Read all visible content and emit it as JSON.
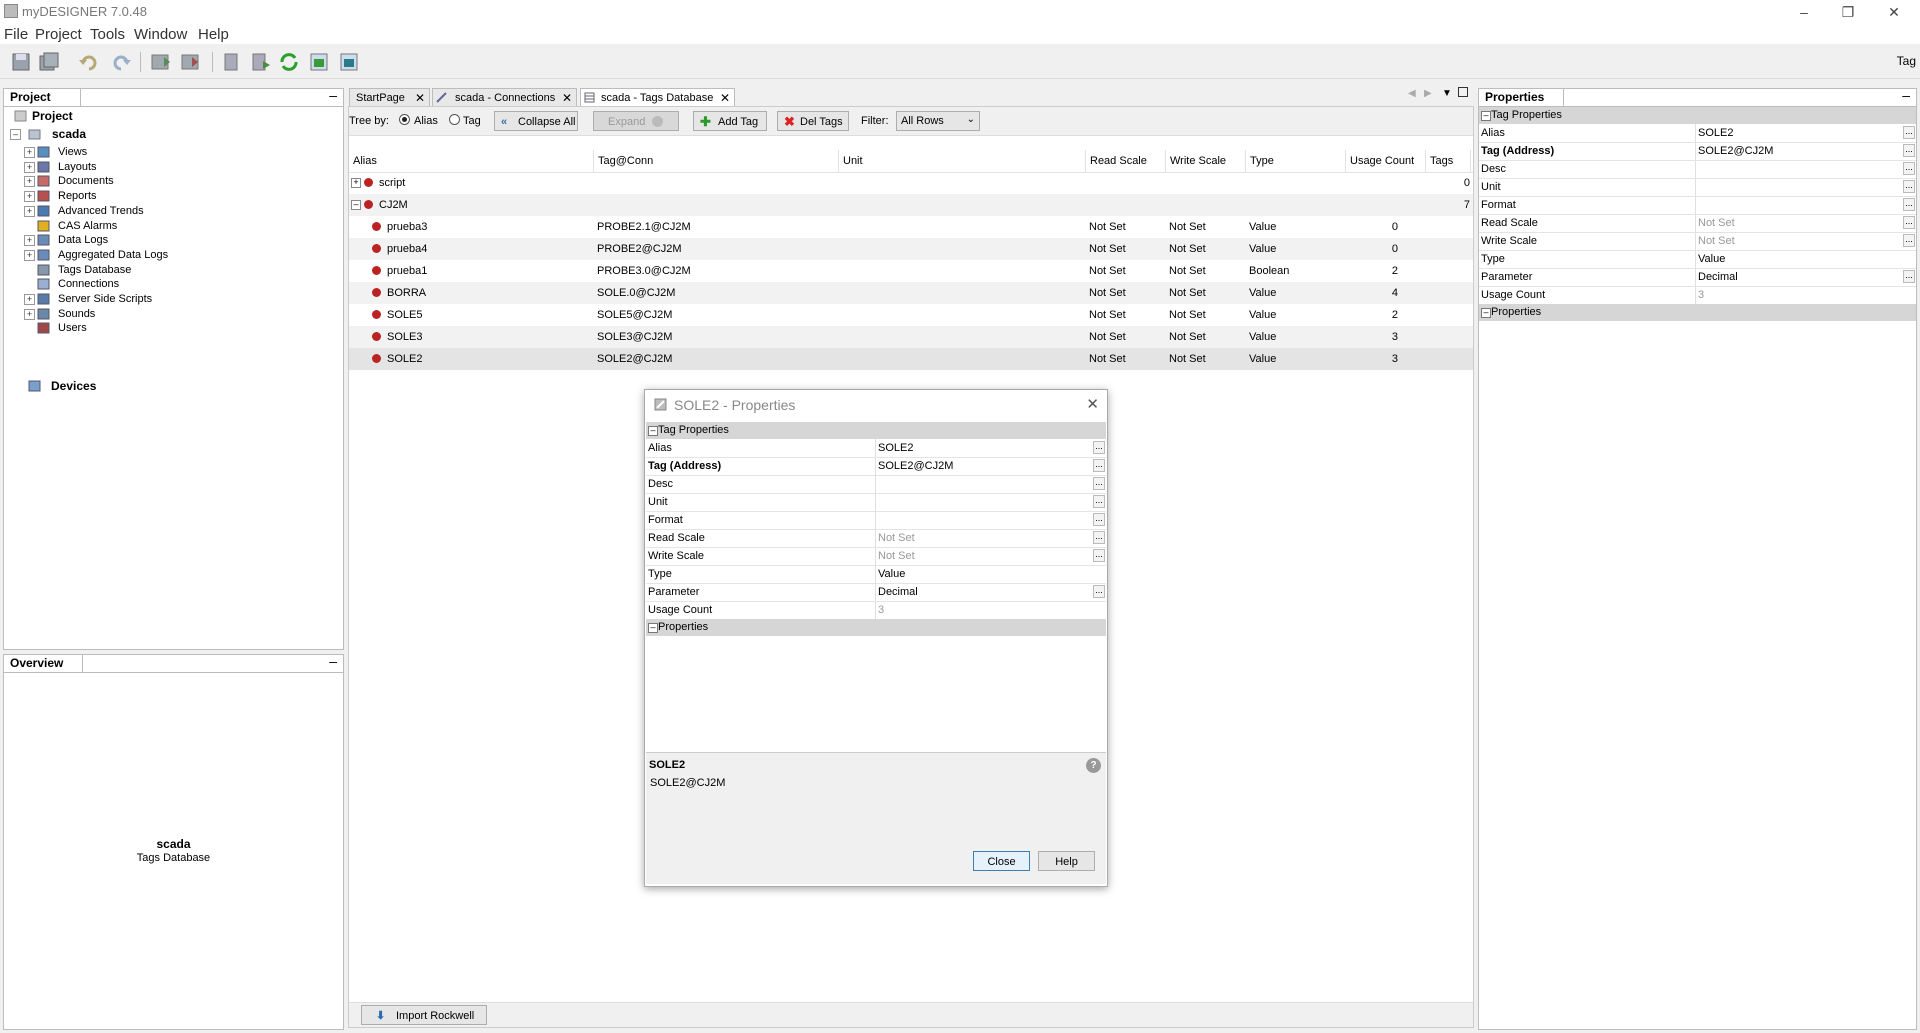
{
  "window": {
    "title": "myDESIGNER 7.0.48",
    "controls": [
      "–",
      "❐",
      "✕"
    ]
  },
  "menu": [
    "File",
    "Project",
    "Tools",
    "Window",
    "Help"
  ],
  "toolbar_right_label": "Tag",
  "project_panel": {
    "title": "Project",
    "root": "Project",
    "project": "scada",
    "items": [
      "Views",
      "Layouts",
      "Documents",
      "Reports",
      "Advanced Trends",
      "CAS Alarms",
      "Data Logs",
      "Aggregated Data Logs",
      "Tags Database",
      "Connections",
      "Server Side Scripts",
      "Sounds",
      "Users"
    ],
    "devices": "Devices"
  },
  "overview_panel": {
    "title": "Overview",
    "line1": "scada",
    "line2": "Tags Database"
  },
  "tabs": [
    "StartPage",
    "scada - Connections",
    "scada - Tags Database"
  ],
  "tags_toolbar": {
    "tree_by": "Tree by:",
    "opt_alias": "Alias",
    "opt_tag": "Tag",
    "collapse_all": "Collapse All",
    "expand": "Expand",
    "add_tag": "Add Tag",
    "del_tags": "Del Tags",
    "filter_label": "Filter:",
    "filter_value": "All Rows"
  },
  "grid": {
    "headers": [
      "Alias",
      "Tag@Conn",
      "Unit",
      "Read Scale",
      "Write Scale",
      "Type",
      "Usage Count",
      "Tags"
    ],
    "groups": [
      {
        "name": "script",
        "tags": "0"
      },
      {
        "name": "CJ2M",
        "tags": "7"
      }
    ],
    "rows": [
      {
        "alias": "prueba3",
        "conn": "PROBE2.1@CJ2M",
        "unit": "",
        "read": "Not Set",
        "write": "Not Set",
        "type": "Value",
        "usage": "0"
      },
      {
        "alias": "prueba4",
        "conn": "PROBE2@CJ2M",
        "unit": "",
        "read": "Not Set",
        "write": "Not Set",
        "type": "Value",
        "usage": "0"
      },
      {
        "alias": "prueba1",
        "conn": "PROBE3.0@CJ2M",
        "unit": "",
        "read": "Not Set",
        "write": "Not Set",
        "type": "Boolean",
        "usage": "2"
      },
      {
        "alias": "BORRA",
        "conn": "SOLE.0@CJ2M",
        "unit": "",
        "read": "Not Set",
        "write": "Not Set",
        "type": "Value",
        "usage": "4"
      },
      {
        "alias": "SOLE5",
        "conn": "SOLE5@CJ2M",
        "unit": "",
        "read": "Not Set",
        "write": "Not Set",
        "type": "Value",
        "usage": "2"
      },
      {
        "alias": "SOLE3",
        "conn": "SOLE3@CJ2M",
        "unit": "",
        "read": "Not Set",
        "write": "Not Set",
        "type": "Value",
        "usage": "3"
      },
      {
        "alias": "SOLE2",
        "conn": "SOLE2@CJ2M",
        "unit": "",
        "read": "Not Set",
        "write": "Not Set",
        "type": "Value",
        "usage": "3"
      }
    ]
  },
  "import_button": "Import Rockwell",
  "properties_panel": {
    "title": "Properties",
    "category1": "Tag Properties",
    "category2": "Properties",
    "props": [
      {
        "name": "Alias",
        "value": "SOLE2",
        "bold": false,
        "dots": true,
        "grey": false
      },
      {
        "name": "Tag (Address)",
        "value": "SOLE2@CJ2M",
        "bold": true,
        "dots": true,
        "grey": false
      },
      {
        "name": "Desc",
        "value": "",
        "bold": false,
        "dots": true,
        "grey": false
      },
      {
        "name": "Unit",
        "value": "",
        "bold": false,
        "dots": true,
        "grey": false
      },
      {
        "name": "Format",
        "value": "",
        "bold": false,
        "dots": true,
        "grey": false
      },
      {
        "name": "Read Scale",
        "value": "Not Set",
        "bold": false,
        "dots": true,
        "grey": true
      },
      {
        "name": "Write Scale",
        "value": "Not Set",
        "bold": false,
        "dots": true,
        "grey": true
      },
      {
        "name": "Type",
        "value": "Value",
        "bold": false,
        "dots": false,
        "grey": false
      },
      {
        "name": "Parameter",
        "value": "Decimal",
        "bold": false,
        "dots": true,
        "grey": false
      },
      {
        "name": "Usage Count",
        "value": "3",
        "bold": false,
        "dots": false,
        "grey": true
      }
    ]
  },
  "dialog": {
    "title": "SOLE2 - Properties",
    "desc_title": "SOLE2",
    "desc_text": "SOLE2@CJ2M",
    "help_icon": "?",
    "close_label": "Close",
    "help_label": "Help"
  }
}
